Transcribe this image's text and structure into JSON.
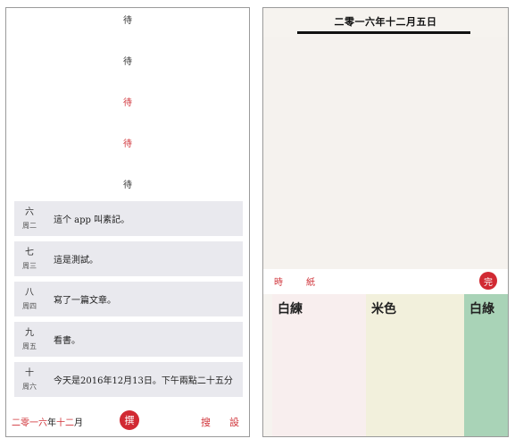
{
  "left": {
    "hour_marks": [
      {
        "label": "待",
        "color": "#333333"
      },
      {
        "label": "待",
        "color": "#333333"
      },
      {
        "label": "待",
        "color": "#d0343a"
      },
      {
        "label": "待",
        "color": "#d0343a"
      },
      {
        "label": "待",
        "color": "#333333"
      }
    ],
    "entries": [
      {
        "day": "六",
        "weekday": "周二",
        "text": "這个 app 叫素記。"
      },
      {
        "day": "七",
        "weekday": "周三",
        "text": "這是測試。"
      },
      {
        "day": "八",
        "weekday": "周四",
        "text": "寫了一篇文章。"
      },
      {
        "day": "九",
        "weekday": "周五",
        "text": "看書。"
      },
      {
        "day": "十",
        "weekday": "周六",
        "text": "今天是2016年12月13日。下午兩點二十五分"
      }
    ],
    "bottom_bar": {
      "year": "二零一六",
      "year_suffix": "年",
      "month": "十二",
      "month_suffix": "月",
      "seal": "撰",
      "search": "搜",
      "settings": "設"
    }
  },
  "right": {
    "title": "二零一六年十二月五日",
    "toolbar": {
      "time": "時",
      "paper": "紙",
      "done": "完"
    },
    "swatches": [
      {
        "label": "白練",
        "color": "#f8eeee"
      },
      {
        "label": "米色",
        "color": "#f2f0dc"
      },
      {
        "label": "白綠",
        "color": "#a9d3b7"
      }
    ]
  },
  "colors": {
    "accent": "#d0343a",
    "entry_bg": "#e9e9ee",
    "paper_bg": "#f5f2ee"
  }
}
